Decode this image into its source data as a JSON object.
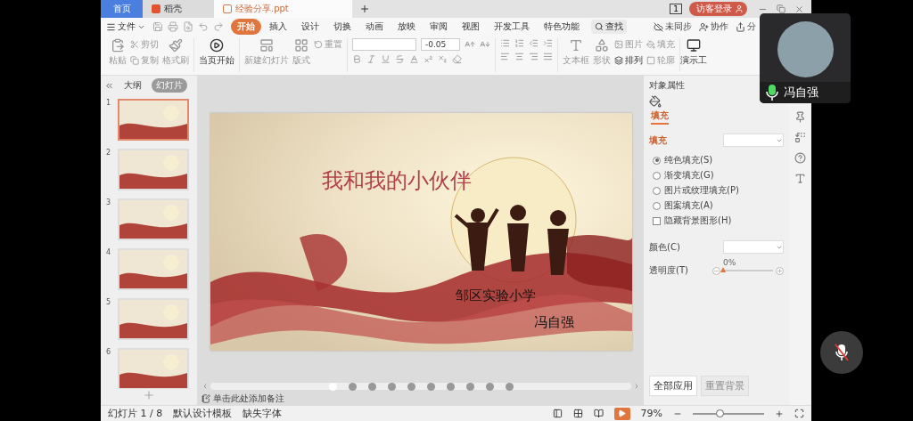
{
  "app_tabs": [
    {
      "label": "首页",
      "kind": "home",
      "selected": false
    },
    {
      "label": "稻壳",
      "kind": "docer",
      "selected": false
    },
    {
      "label": "经验分享.ppt",
      "kind": "document",
      "selected": true
    }
  ],
  "window_badge": "1",
  "login_button": "访客登录",
  "menu": {
    "file": "文件",
    "tabs": [
      {
        "label": "开始",
        "selected": true
      },
      {
        "label": "插入",
        "selected": false
      },
      {
        "label": "设计",
        "selected": false
      },
      {
        "label": "切换",
        "selected": false
      },
      {
        "label": "动画",
        "selected": false
      },
      {
        "label": "放映",
        "selected": false
      },
      {
        "label": "审阅",
        "selected": false
      },
      {
        "label": "视图",
        "selected": false
      },
      {
        "label": "开发工具",
        "selected": false
      },
      {
        "label": "特色功能",
        "selected": false
      }
    ],
    "search": "查找",
    "sync": "未同步",
    "collaborate": "协作",
    "share": "分"
  },
  "ribbon": {
    "paste": "粘贴",
    "cut": "剪切",
    "copy": "复制",
    "format_painter": "格式刷",
    "play_from_current": "当页开始",
    "new_slide": "新建幻灯片",
    "layout": "版式",
    "reset": "重置",
    "font_size": "-0.05",
    "text_box": "文本框",
    "shape": "形状",
    "picture": "图片",
    "fill": "填充",
    "arrange": "排列",
    "outline": "轮廓",
    "presentation_tools": "演示工"
  },
  "slides_panel": {
    "tabs": [
      {
        "label": "大纲",
        "selected": false
      },
      {
        "label": "幻灯片",
        "selected": true
      }
    ],
    "slides": [
      {
        "number": "1",
        "selected": true
      },
      {
        "number": "2",
        "selected": false
      },
      {
        "number": "3",
        "selected": false
      },
      {
        "number": "4",
        "selected": false
      },
      {
        "number": "5",
        "selected": false
      },
      {
        "number": "6",
        "selected": false
      }
    ]
  },
  "slide": {
    "title": "我和我的小伙伴",
    "subtitle": "邹区实验小学",
    "author": "冯自强"
  },
  "slide_nav": {
    "pages": [
      {
        "selected": true
      },
      {
        "selected": false
      },
      {
        "selected": false
      },
      {
        "selected": false
      },
      {
        "selected": false
      },
      {
        "selected": false
      },
      {
        "selected": false
      },
      {
        "selected": false
      },
      {
        "selected": false
      },
      {
        "selected": false
      }
    ]
  },
  "notes_placeholder": "单击此处添加备注",
  "properties": {
    "title": "对象属性",
    "tab": "填充",
    "section": "填充",
    "options": [
      {
        "label": "纯色填充(S)",
        "kind": "radio",
        "checked": true
      },
      {
        "label": "渐变填充(G)",
        "kind": "radio",
        "checked": false
      },
      {
        "label": "图片或纹理填充(P)",
        "kind": "radio",
        "checked": false
      },
      {
        "label": "图案填充(A)",
        "kind": "radio",
        "checked": false
      },
      {
        "label": "隐藏背景图形(H)",
        "kind": "checkbox",
        "checked": false
      }
    ],
    "color_label": "颜色(C)",
    "transparency_label": "透明度(T)",
    "transparency": {
      "reading": "0%",
      "level": 0
    },
    "buttons": [
      {
        "label": "全部应用",
        "disabled": false
      },
      {
        "label": "重置背景",
        "disabled": true
      }
    ]
  },
  "status_bar": {
    "slide_counter": "幻灯片 1 / 8",
    "template": "默认设计模板",
    "missing_fonts": "缺失字体",
    "zoom": "79%",
    "zoom_slider": {
      "level": 0.37
    }
  },
  "participant": {
    "name": "冯自强",
    "mic_on": true
  },
  "mic_button": {
    "muted": true
  }
}
